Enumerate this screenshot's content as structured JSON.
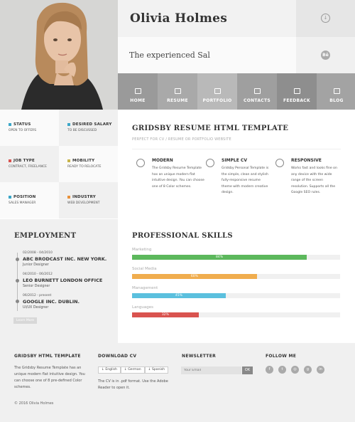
{
  "header": {
    "name": "Olivia Holmes",
    "tagline": "The experienced Sal",
    "download_icon": "arrow-down-circle-icon",
    "behance_label": "Bē"
  },
  "nav": [
    {
      "label": "HOME",
      "icon": "home-icon",
      "color": "#9a9a9a"
    },
    {
      "label": "RESUME",
      "icon": "resume-icon",
      "color": "#a9a9a9"
    },
    {
      "label": "PORTFOLIO",
      "icon": "portfolio-icon",
      "color": "#b9b9b9"
    },
    {
      "label": "CONTACTS",
      "icon": "contacts-icon",
      "color": "#9f9f9f"
    },
    {
      "label": "FEEDBACK",
      "icon": "feedback-icon",
      "color": "#8e8e8e"
    },
    {
      "label": "BLOG",
      "icon": "blog-icon",
      "color": "#a3a3a3"
    }
  ],
  "info": [
    {
      "title": "STATUS",
      "value": "OPEN TO OFFERS",
      "color": "#3aa6c8"
    },
    {
      "title": "DESIRED SALARY",
      "value": "TO BE DISCUSSED",
      "color": "#3aa6c8"
    },
    {
      "title": "JOB TYPE",
      "value": "CONTRACT, FREELANCE",
      "color": "#d9534f"
    },
    {
      "title": "MOBILITY",
      "value": "READY TO RELOCATE",
      "color": "#c8b44a"
    },
    {
      "title": "POSITION",
      "value": "SALES MANAGER",
      "color": "#3aa6c8"
    },
    {
      "title": "INDUSTRY",
      "value": "WEB DEVELOPMENT",
      "color": "#e8913a"
    }
  ],
  "intro": {
    "title": "GRIDSBY RESUME HTML TEMPLATE",
    "subtitle": "PERFECT FOR CV / RESUME OR PORTFOLIO WEBSITE",
    "features": [
      {
        "title": "MODERN",
        "text": "The Gridsby Resume Template has an unique modern flat intuitive design. You can choose one of 8 Color schemes.",
        "icon": "hexagon-icon"
      },
      {
        "title": "SIMPLE CV",
        "text": "Gridsby Personal Template is the simple, clean and stylish fully-responsive resume theme with modern creative design.",
        "icon": "heart-icon"
      },
      {
        "title": "RESPONSIVE",
        "text": "Works fast and looks fine on any device with the wide range of the screen resolution. Supports all the Google SEO rules.",
        "icon": "target-icon"
      }
    ]
  },
  "employment": {
    "title": "EMPLOYMENT",
    "jobs": [
      {
        "dates": "02/2008 - 04/2010",
        "company": "ABC BRODCAST INC. NEW YORK.",
        "role": "Junior Designer"
      },
      {
        "dates": "04/2010 - 06/2012",
        "company": "LEO BURNETT LONDON OFFICE",
        "role": "Senior Designer"
      },
      {
        "dates": "06/2012 - present",
        "company": "GOOGLE INC. DUBLIN.",
        "role": "UI/UX Designer"
      }
    ],
    "button": "Learn More"
  },
  "skills": {
    "title": "PROFESSIONAL SKILLS",
    "items": [
      {
        "label": "Marketing",
        "percent": 84,
        "text": "84%",
        "color": "#5cb85c"
      },
      {
        "label": "Social Media",
        "percent": 60,
        "text": "60%",
        "color": "#f0ad4e"
      },
      {
        "label": "Management",
        "percent": 45,
        "text": "45%",
        "color": "#5bc0de"
      },
      {
        "label": "Languages",
        "percent": 32,
        "text": "32%",
        "color": "#d9534f"
      }
    ]
  },
  "footer": {
    "about_title": "GRIDSBY HTML TEMPLATE",
    "about_text": "The Gridsby Resume Template has an unique modern flat intuitive design. You can choose one of 8 pre-defined Color schemes.",
    "download_title": "DOWNLOAD CV",
    "languages": [
      "English",
      "German",
      "Spanish"
    ],
    "download_note": "The CV is in .pdf format. Use the Adobe Reader to open it.",
    "newsletter_title": "NEWSLETTER",
    "email_placeholder": "Your Email",
    "ok_label": "OK",
    "follow_title": "FOLLOW ME",
    "socials": [
      "f",
      "t",
      "◎",
      "g",
      "in"
    ],
    "copyright": "© 2016 Olivia Holmes"
  }
}
